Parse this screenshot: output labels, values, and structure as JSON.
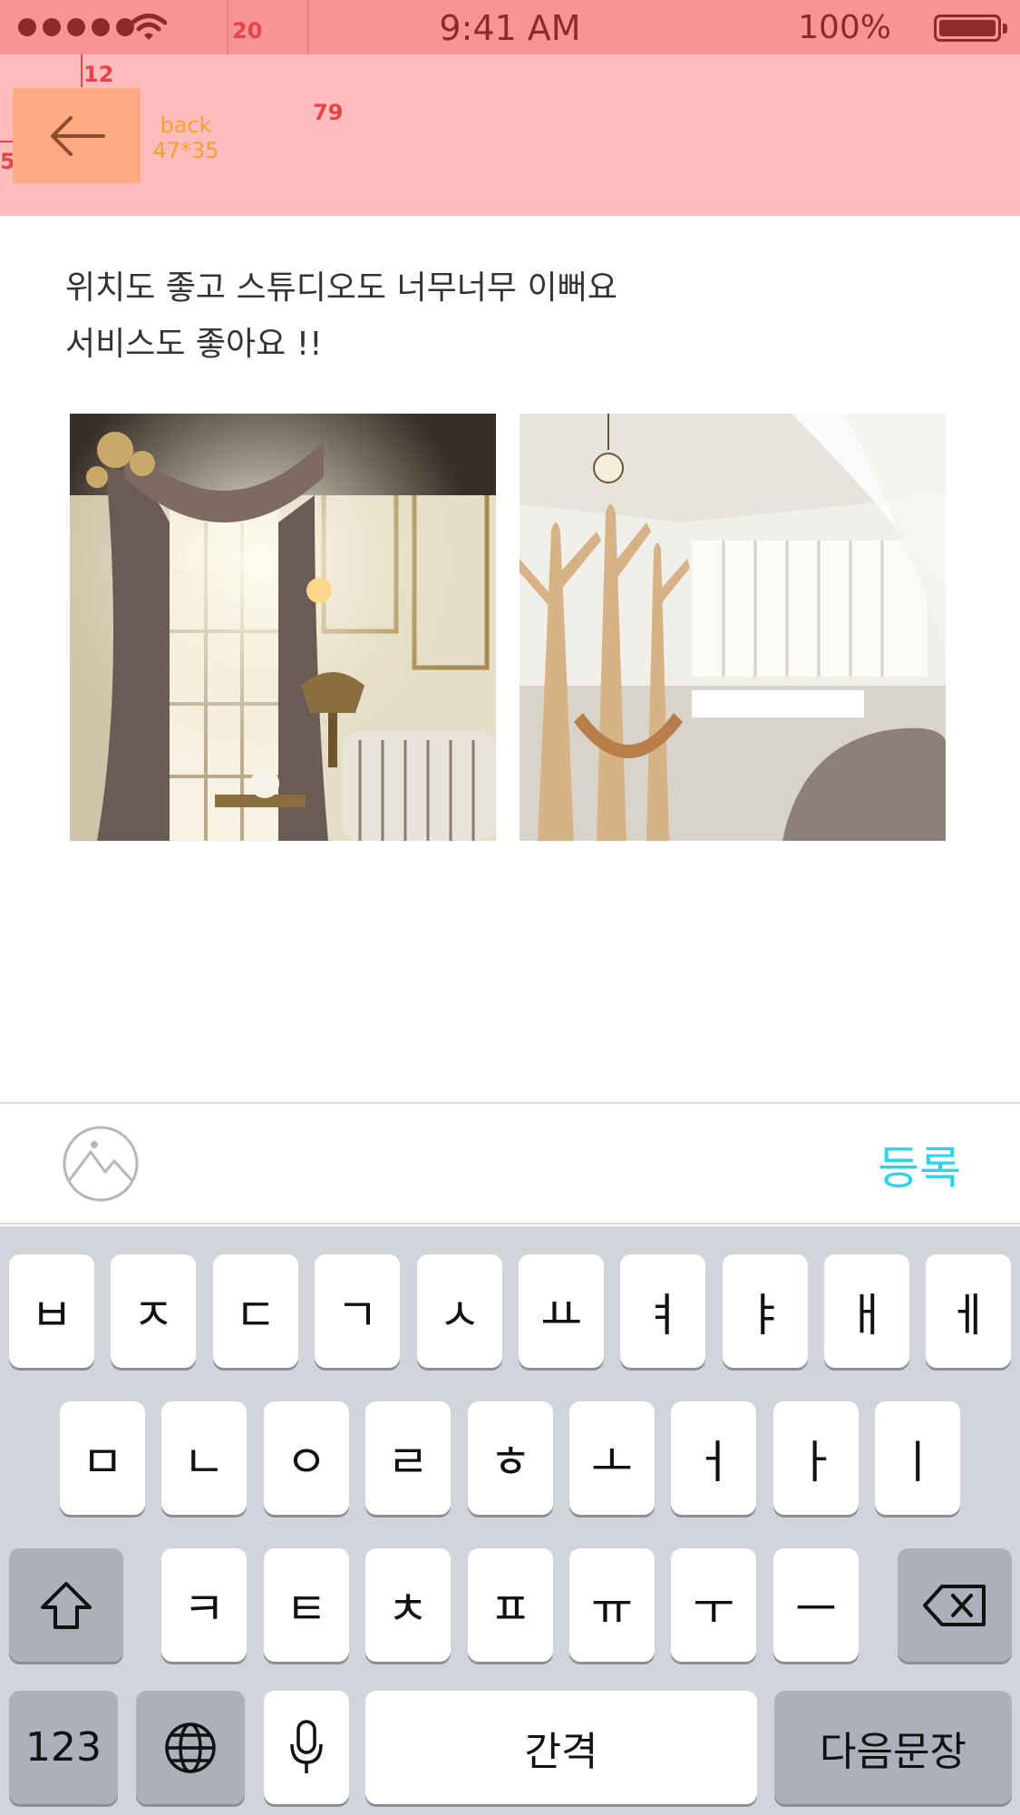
{
  "status_bar": {
    "time": "9:41 AM",
    "battery": "100%",
    "signal_bars": 5
  },
  "spec_annotations": {
    "status_height": "20",
    "top_margin": "12",
    "nav_height": "79",
    "left_margin": "5",
    "back_label": "back",
    "back_size": "47*35"
  },
  "review": {
    "line1": "위치도 좋고 스튜디오도 너무너무 이뻐요",
    "line2": "서비스도 좋아요 !!"
  },
  "photos": [
    {
      "icon": "studio-photo-1",
      "alt": "classic interior with chandelier and curtains"
    },
    {
      "icon": "studio-photo-2",
      "alt": "white studio with wooden trees"
    }
  ],
  "input_bar": {
    "register_label": "등록",
    "photo_icon": "mountain-photo-icon"
  },
  "keyboard": {
    "row1": [
      "ㅂ",
      "ㅈ",
      "ㄷ",
      "ㄱ",
      "ㅅ",
      "ㅛ",
      "ㅕ",
      "ㅑ",
      "ㅐ",
      "ㅔ"
    ],
    "row2": [
      "ㅁ",
      "ㄴ",
      "ㅇ",
      "ㄹ",
      "ㅎ",
      "ㅗ",
      "ㅓ",
      "ㅏ",
      "ㅣ"
    ],
    "row3": [
      "ㅋ",
      "ㅌ",
      "ㅊ",
      "ㅍ",
      "ㅠ",
      "ㅜ",
      "ㅡ"
    ],
    "numbers_label": "123",
    "space_label": "간격",
    "return_label": "다음문장"
  },
  "colors": {
    "accent": "#2ed3e6",
    "status_bg": "#f99496",
    "nav_bg": "#ffbcbd",
    "keyboard_bg": "#d1d4da"
  }
}
